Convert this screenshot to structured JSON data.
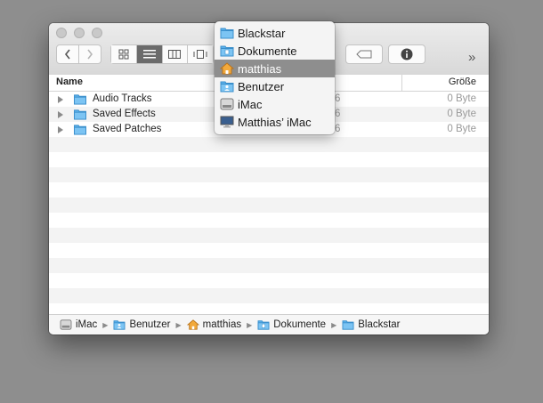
{
  "window": {
    "columns": {
      "name": "Name",
      "size": "Größe"
    },
    "rows": [
      {
        "name": "Audio Tracks",
        "date_fragment": "6",
        "size": "0 Byte"
      },
      {
        "name": "Saved Effects",
        "date_fragment": "6",
        "size": "0 Byte"
      },
      {
        "name": "Saved Patches",
        "date_fragment": "6",
        "size": "0 Byte"
      }
    ],
    "toolbar": {
      "overflow": "»"
    }
  },
  "path_bar": [
    "iMac",
    "Benutzer",
    "matthias",
    "Dokumente",
    "Blackstar"
  ],
  "path_menu": {
    "items": [
      {
        "label": "Blackstar",
        "icon": "folder-icon"
      },
      {
        "label": "Dokumente",
        "icon": "documents-folder-icon"
      },
      {
        "label": "matthias",
        "icon": "home-folder-icon",
        "selected": true
      },
      {
        "label": "Benutzer",
        "icon": "users-folder-icon"
      },
      {
        "label": "iMac",
        "icon": "hard-drive-icon"
      },
      {
        "label": "Matthias’ iMac",
        "icon": "computer-icon"
      }
    ]
  },
  "colors": {
    "accent_folder": "#5ab1ec",
    "selection": "#8e8e8e"
  }
}
